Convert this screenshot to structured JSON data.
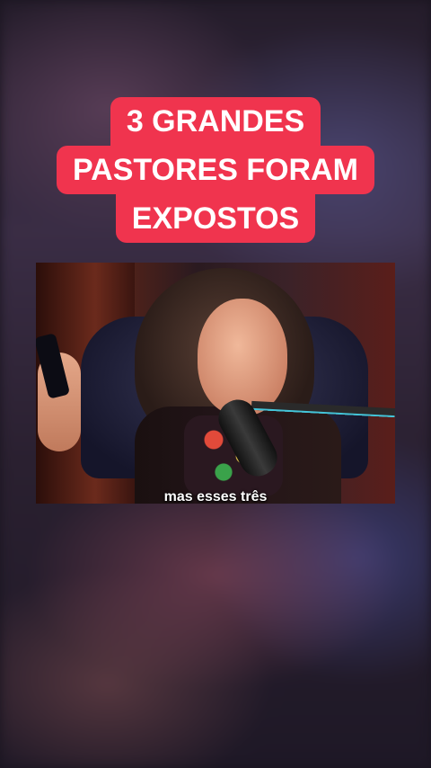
{
  "overlay_title": {
    "line1": "3 GRANDES",
    "line2": "PASTORES FORAM",
    "line3": "EXPOSTOS",
    "background_color": "#f0344e",
    "text_color": "#ffffff"
  },
  "video": {
    "subtitle": "mas esses três"
  }
}
